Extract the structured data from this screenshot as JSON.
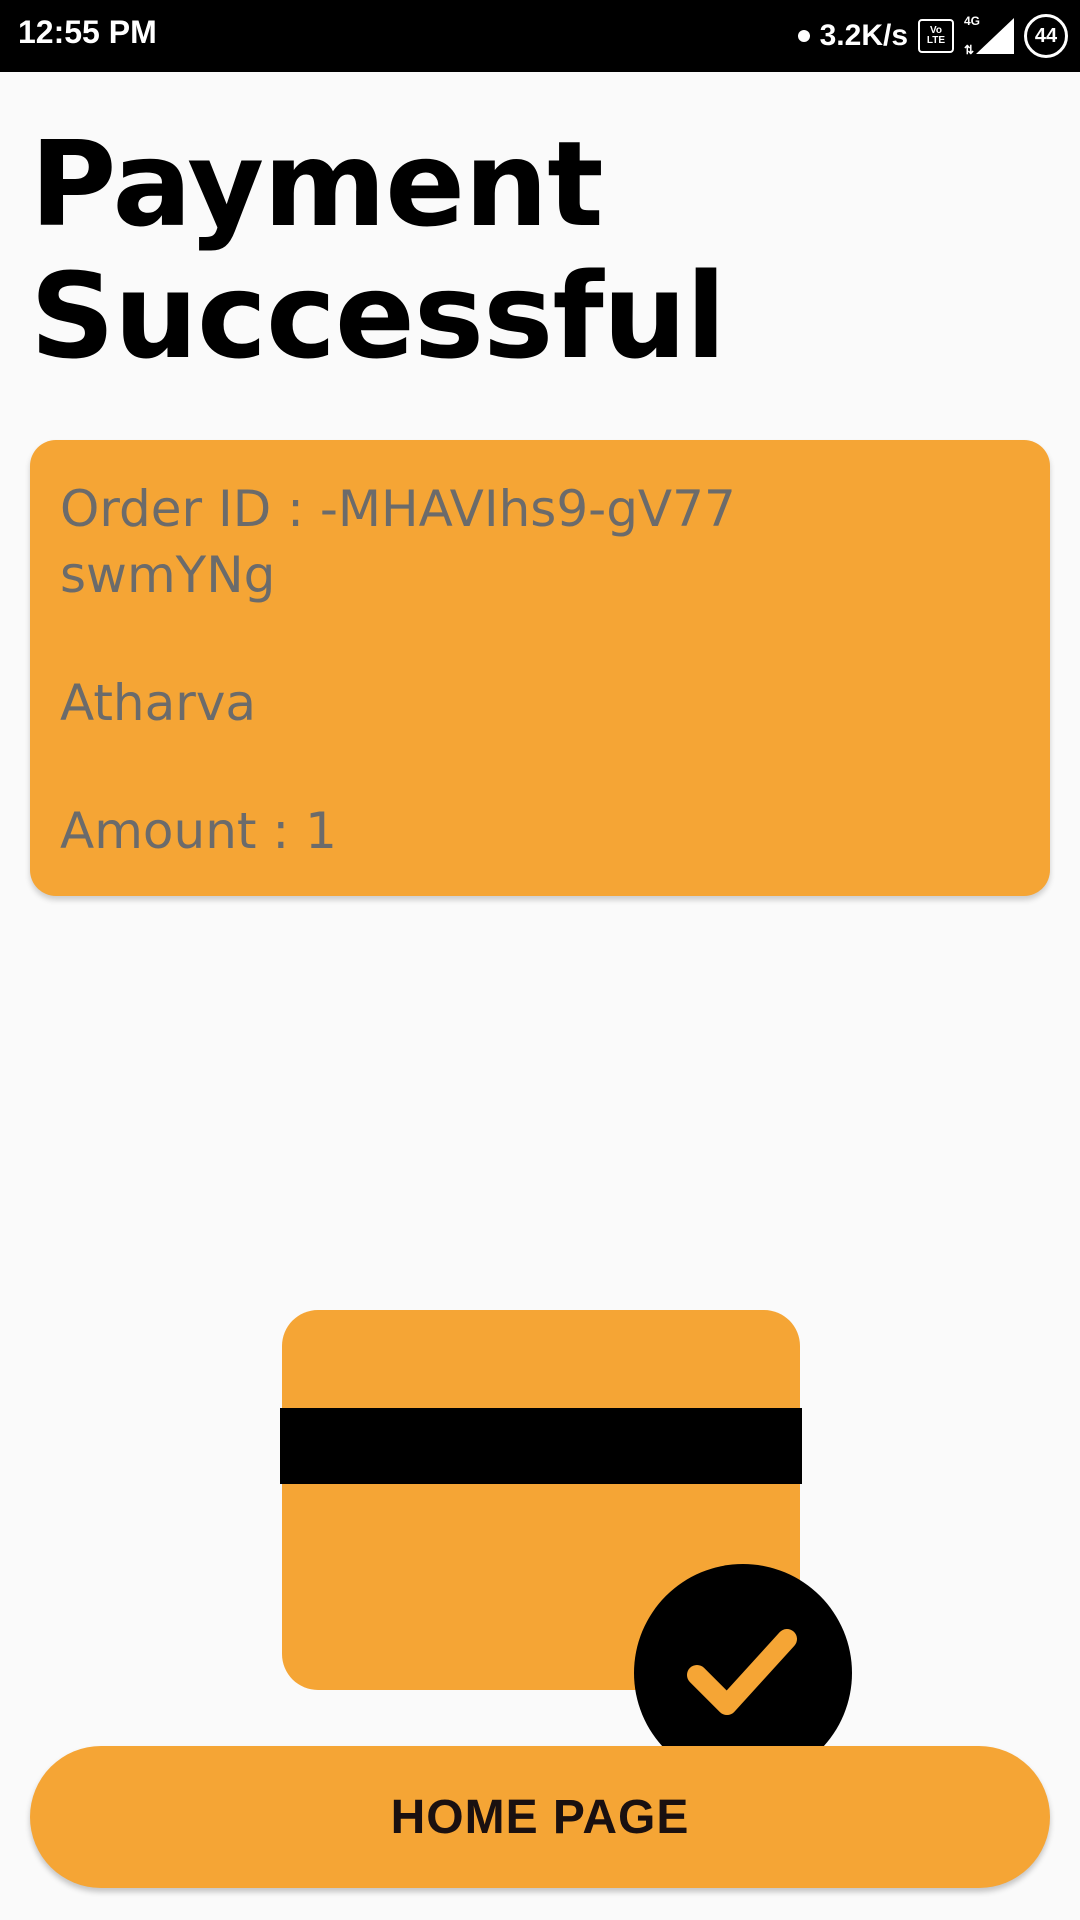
{
  "status_bar": {
    "time": "12:55 PM",
    "speed": "3.2K/s",
    "volte_top": "Vo",
    "volte_bottom": "LTE",
    "network": "4G",
    "battery": "44"
  },
  "page": {
    "title_line1": "Payment",
    "title_line2": "Successful"
  },
  "order": {
    "order_id": "Order ID : -MHAVIhs9-gV77swmYNg",
    "name": "Atharva",
    "amount": "Amount : 1"
  },
  "home_button": {
    "label": "HOME PAGE"
  },
  "colors": {
    "accent": "#f5a535",
    "background": "#fafafa",
    "text_muted": "#6b6b6b"
  },
  "icons": [
    "volte-icon",
    "signal-icon",
    "battery-icon",
    "credit-card-icon",
    "checkmark-icon"
  ]
}
